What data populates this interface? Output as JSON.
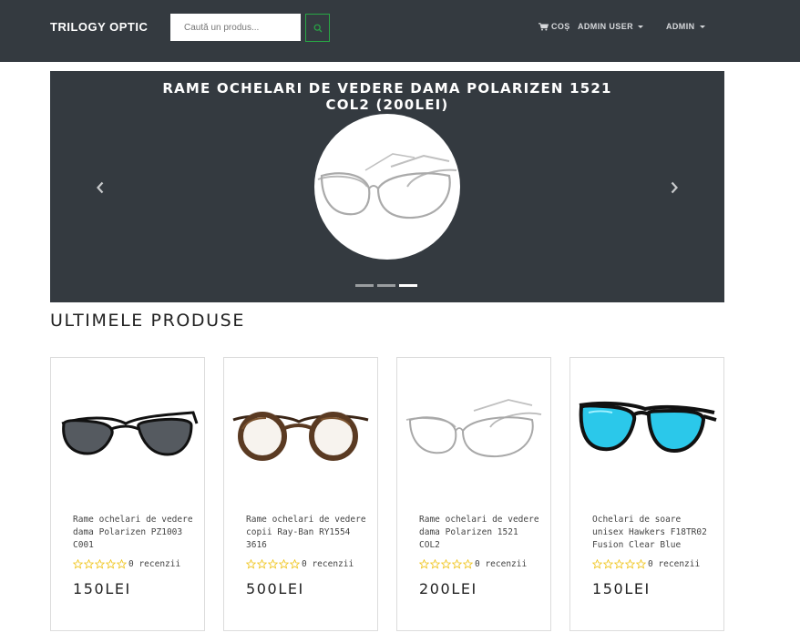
{
  "navbar": {
    "brand": "TRILOGY OPTIC",
    "search_placeholder": "Caută un produs...",
    "cart_label": "COȘ",
    "user_menu_label": "ADMIN USER",
    "admin_menu_label": "ADMIN"
  },
  "carousel": {
    "title": "RAME OCHELARI DE VEDERE DAMA POLARIZEN 1521 COL2 (200LEI)",
    "indicator_count": 3,
    "active_indicator": 3
  },
  "section": {
    "title": "ULTIMELE PRODUSE"
  },
  "products": [
    {
      "name": "Rame ochelari de vedere dama Polarizen PZ1003 C001",
      "rating": 0,
      "reviews": "0 recenzii",
      "price": "150LEI"
    },
    {
      "name": "Rame ochelari de vedere copii Ray-Ban RY1554 3616",
      "rating": 0,
      "reviews": "0 recenzii",
      "price": "500LEI"
    },
    {
      "name": "Rame ochelari de vedere dama Polarizen 1521 COL2",
      "rating": 0,
      "reviews": "0 recenzii",
      "price": "200LEI"
    },
    {
      "name": "Ochelari de soare unisex Hawkers F18TR02 Fusion Clear Blue",
      "rating": 0,
      "reviews": "0 recenzii",
      "price": "150LEI"
    }
  ],
  "icons": {
    "search": "search-icon",
    "cart": "cart-icon",
    "prev": "chevron-left-icon",
    "next": "chevron-right-icon",
    "star": "star-outline-icon"
  },
  "colors": {
    "navbar_bg": "#343a40",
    "accent_green": "#28a745",
    "star_color": "#f0c419"
  }
}
